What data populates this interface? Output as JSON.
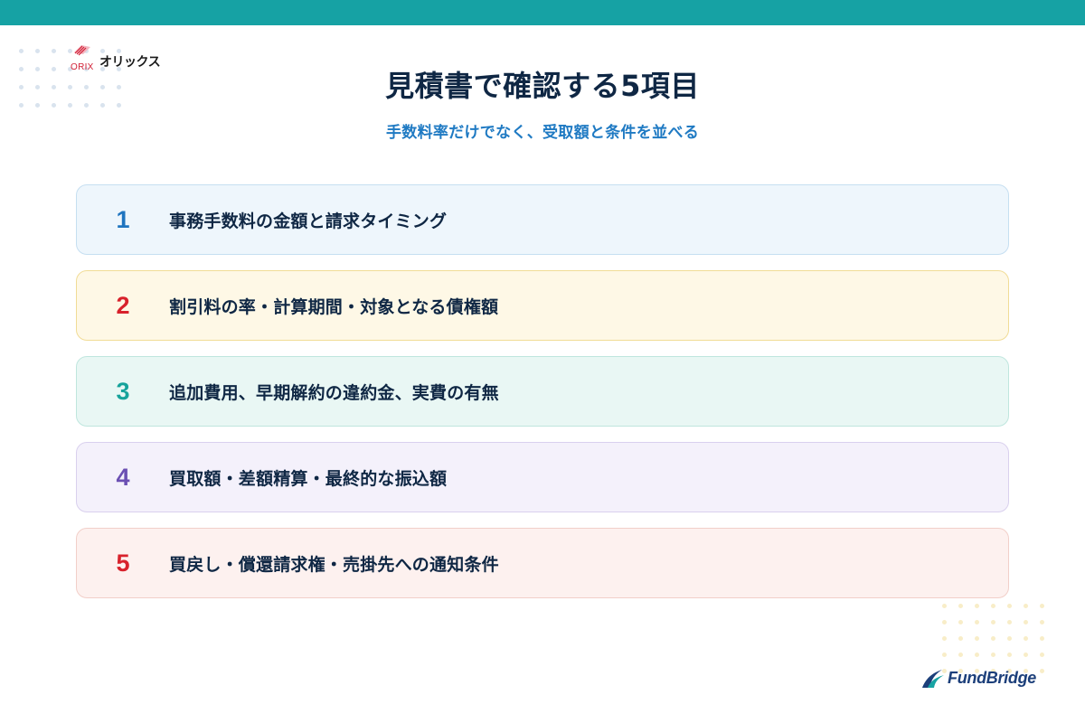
{
  "brand": {
    "orix_word": "ORIX",
    "name": "オリックス"
  },
  "page": {
    "title": "見積書で確認する5項目",
    "subtitle": "手数料率だけでなく、受取額と条件を並べる"
  },
  "items": [
    {
      "number": "1",
      "text": "事務手数料の金額と請求タイミング",
      "accent": "#1f74bf",
      "bg": "#eef6fc",
      "border": "#c6dff1"
    },
    {
      "number": "2",
      "text": "割引料の率・計算期間・対象となる債権額",
      "accent": "#d8222c",
      "bg": "#fef8e6",
      "border": "#f1dc96"
    },
    {
      "number": "3",
      "text": "追加費用、早期解約の違約金、実費の有無",
      "accent": "#17a39b",
      "bg": "#e9f7f4",
      "border": "#bfe6de"
    },
    {
      "number": "4",
      "text": "買取額・差額精算・最終的な振込額",
      "accent": "#6b4fb3",
      "bg": "#f4f1fb",
      "border": "#d9d0ee"
    },
    {
      "number": "5",
      "text": "買戻し・償還請求権・売掛先への通知条件",
      "accent": "#d8222c",
      "bg": "#fdf1ef",
      "border": "#f2cfc9"
    }
  ],
  "footer": {
    "logo_text": "FundBridge"
  },
  "colors": {
    "top_band": "#16a2a4",
    "title": "#0f2744",
    "subtitle": "#1f7ac3"
  }
}
